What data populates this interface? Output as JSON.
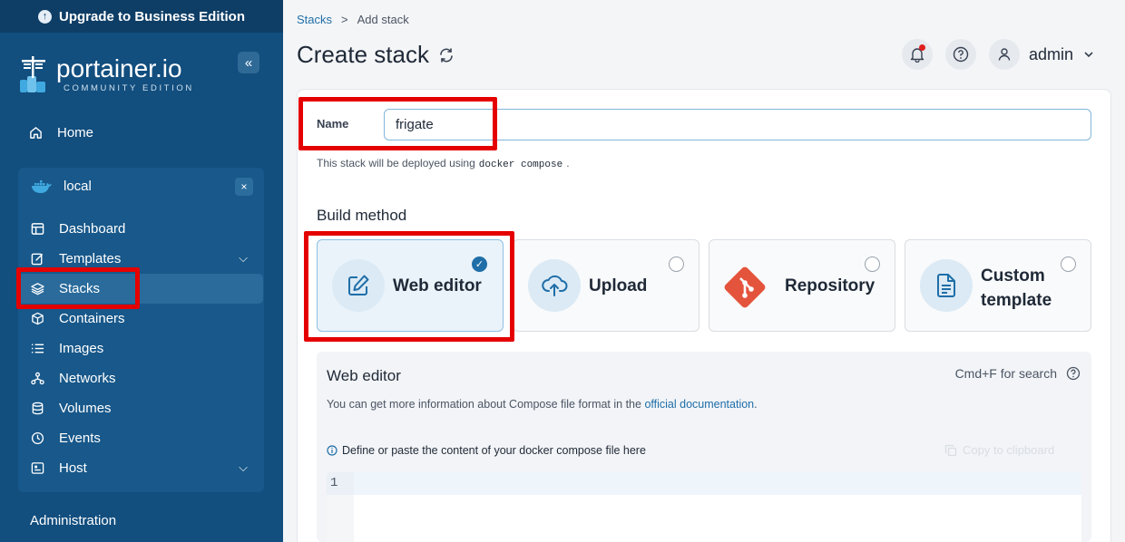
{
  "sidebar": {
    "upgrade_label": "Upgrade to Business Edition",
    "logo_word": "portainer.io",
    "logo_sub": "COMMUNITY EDITION",
    "collapse_icon": "«",
    "home_label": "Home",
    "env_name": "local",
    "env_close": "×",
    "items": [
      {
        "label": "Dashboard",
        "icon": "dashboard-icon"
      },
      {
        "label": "Templates",
        "icon": "templates-icon"
      },
      {
        "label": "Stacks",
        "icon": "stacks-icon"
      },
      {
        "label": "Containers",
        "icon": "containers-icon"
      },
      {
        "label": "Images",
        "icon": "images-icon"
      },
      {
        "label": "Networks",
        "icon": "networks-icon"
      },
      {
        "label": "Volumes",
        "icon": "volumes-icon"
      },
      {
        "label": "Events",
        "icon": "events-icon"
      },
      {
        "label": "Host",
        "icon": "host-icon"
      }
    ],
    "admin_label": "Administration"
  },
  "breadcrumb": {
    "root": "Stacks",
    "sep": ">",
    "current": "Add stack"
  },
  "header": {
    "title": "Create stack",
    "user": "admin"
  },
  "form": {
    "name_label": "Name",
    "name_value": "frigate",
    "hint_prefix": "This stack will be deployed using",
    "hint_code": "docker compose",
    "hint_suffix": ".",
    "build_method_label": "Build method",
    "methods": [
      {
        "label": "Web editor",
        "selected": true
      },
      {
        "label": "Upload",
        "selected": false
      },
      {
        "label": "Repository",
        "selected": false
      },
      {
        "label": "Custom template",
        "selected": false
      }
    ]
  },
  "editor": {
    "title": "Web editor",
    "search_hint": "Cmd+F for search",
    "info_prefix": "You can get more information about Compose file format in the",
    "info_link": "official documentation",
    "info_suffix": ".",
    "define_text": "Define or paste the content of your docker compose file here",
    "copy_label": "Copy to clipboard",
    "line_number": "1"
  },
  "colors": {
    "sidebar": "#124e7e",
    "accent": "#1f6ea8",
    "highlight": "#e50000"
  }
}
